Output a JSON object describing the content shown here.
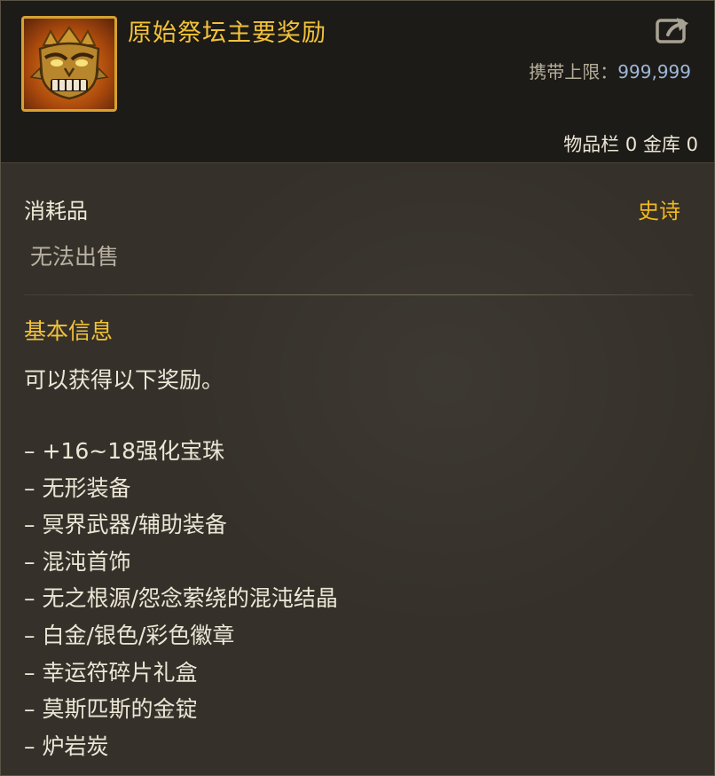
{
  "item": {
    "title": "原始祭坛主要奖励",
    "icon": "demon-mask-icon",
    "carry_limit_label": "携带上限：",
    "carry_limit_value": "999,999",
    "inventory_label": "物品栏",
    "inventory_count": "0",
    "storage_label": "金库",
    "storage_count": "0",
    "share_icon": "share-export-icon"
  },
  "details": {
    "category": "消耗品",
    "rarity": "史诗",
    "trade_note": "无法出售",
    "section_title": "基本信息",
    "description": "可以获得以下奖励。",
    "dash": "–",
    "rewards": [
      "+16~18强化宝珠",
      "无形装备",
      "冥界武器/辅助装备",
      "混沌首饰",
      "无之根源/怨念萦绕的混沌结晶",
      "白金/银色/彩色徽章",
      "幸运符碎片礼盒",
      "莫斯匹斯的金锭",
      "炉岩炭"
    ]
  },
  "colors": {
    "title": "#f2c23a",
    "rarity_epic": "#f2b81c",
    "carry_value": "#9fb7d8",
    "icon_border": "#d3a232"
  }
}
